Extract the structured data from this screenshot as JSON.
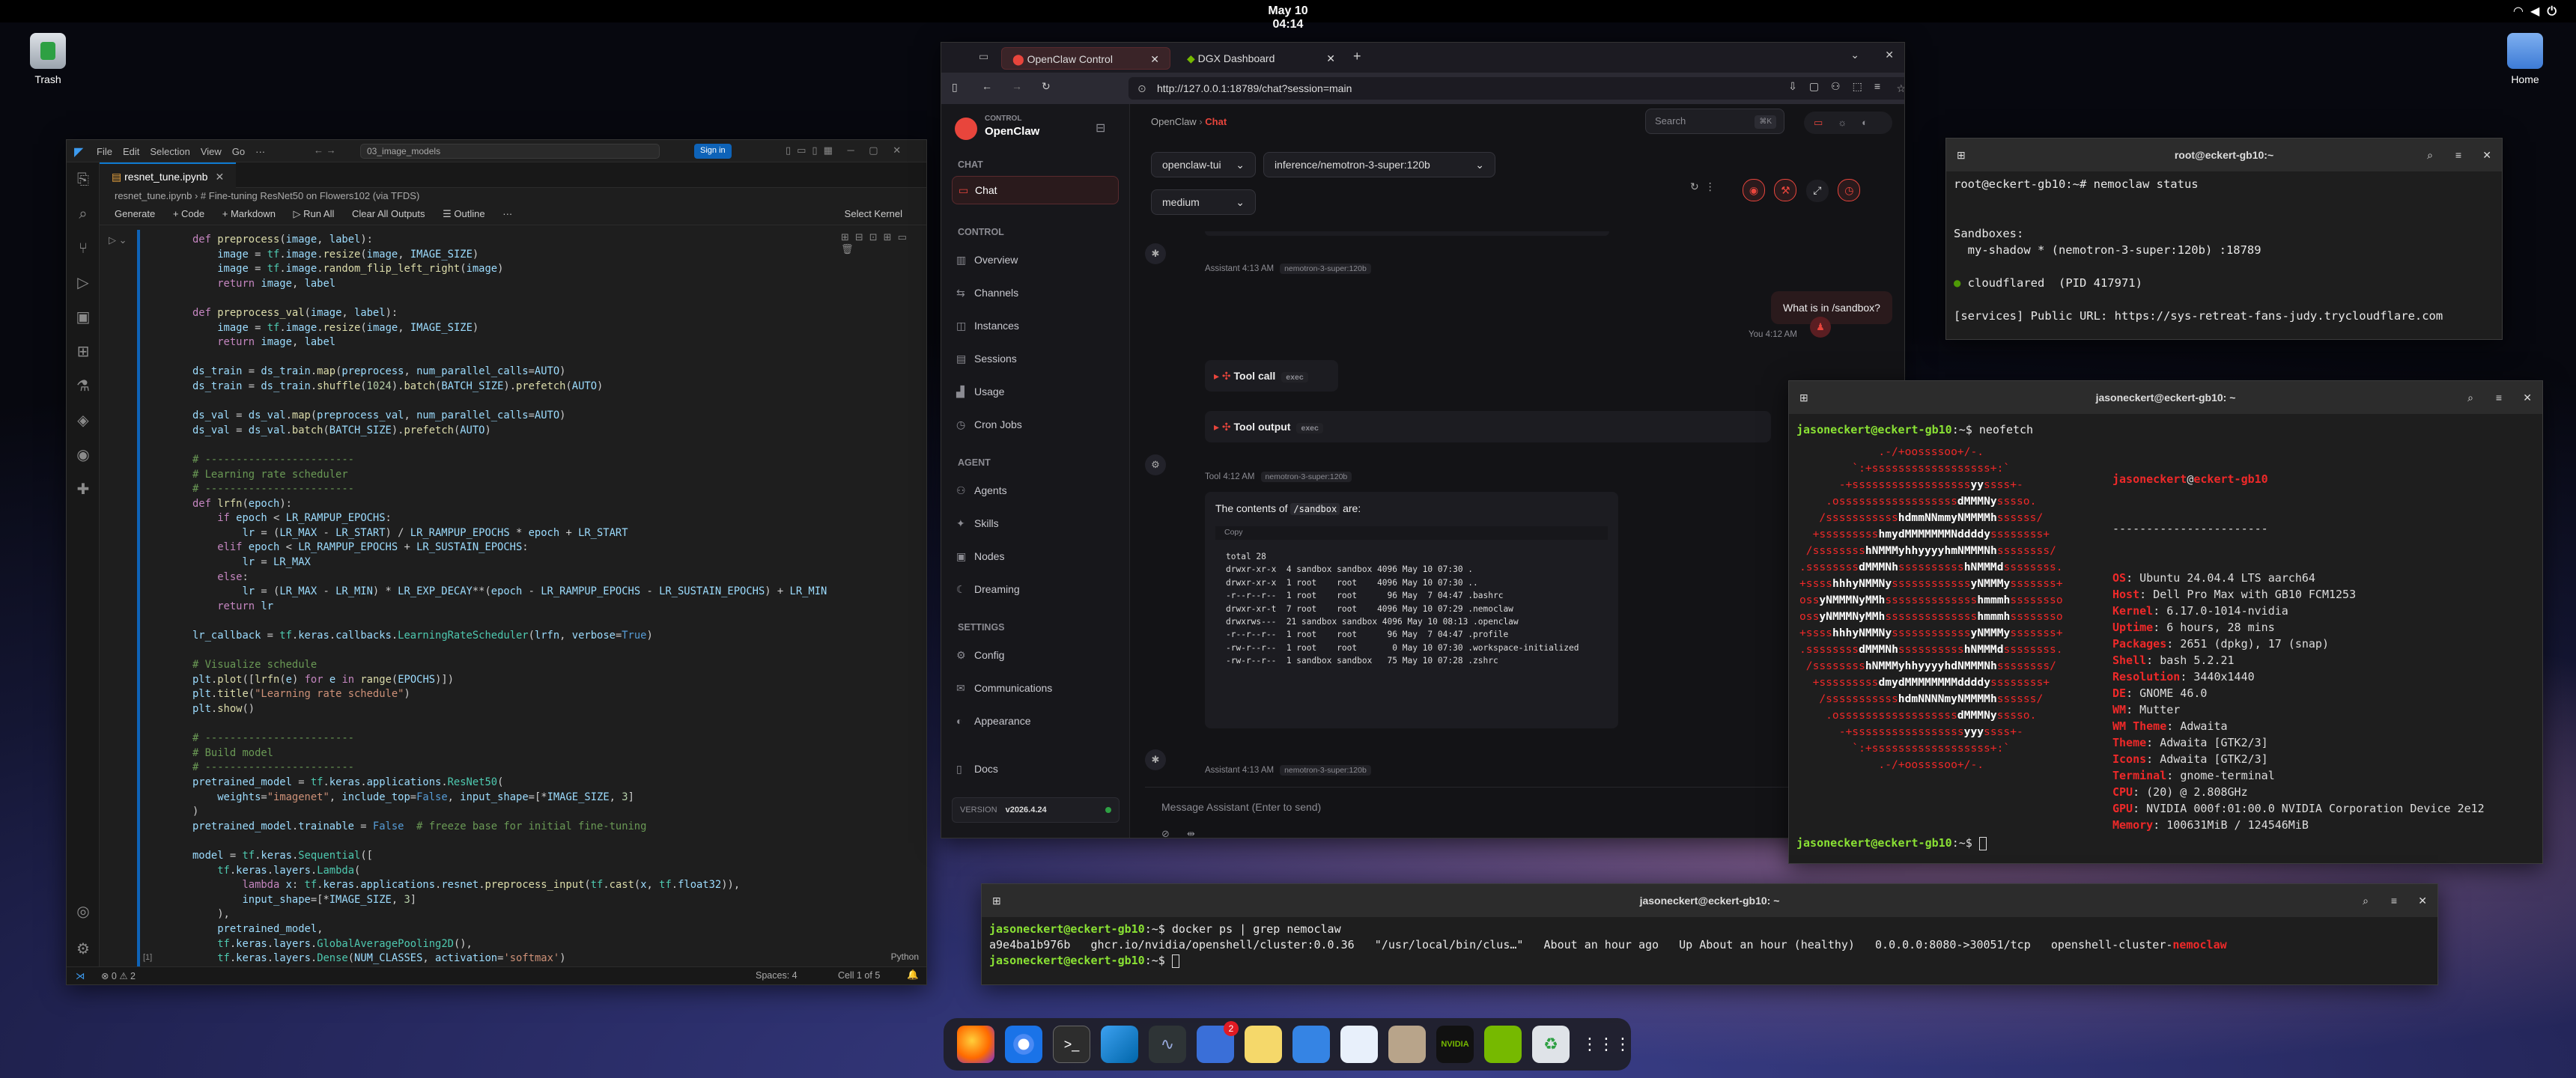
{
  "topbar": {
    "clock": "May 10  04:14"
  },
  "desktop": {
    "trash": "Trash",
    "home": "Home"
  },
  "vscode": {
    "menu": [
      "File",
      "Edit",
      "Selection",
      "View",
      "Go",
      "···"
    ],
    "search": "03_image_models",
    "signin": "Sign in",
    "tab": "resnet_tune.ipynb",
    "breadcrumb": "resnet_tune.ipynb  ›  # Fine-tuning ResNet50 on Flowers102 (via TFDS)",
    "toolbar": [
      "Generate",
      "+ Code",
      "+ Markdown",
      "▷ Run All",
      "Clear All Outputs",
      "☰ Outline",
      "···"
    ],
    "kernel": "Select Kernel",
    "cell_index": "[1]",
    "lang": "Python",
    "status": {
      "left": "⊗ 0 ⚠ 2",
      "spaces": "Spaces: 4",
      "cell": "Cell 1 of 5"
    }
  },
  "firefox": {
    "tab1": "OpenClaw Control",
    "tab2": "DGX Dashboard",
    "url": "http://127.0.0.1:18789/chat?session=main"
  },
  "openclaw": {
    "brand_small": "CONTROL",
    "brand": "OpenClaw",
    "crumb_root": "OpenClaw",
    "crumb_current": "Chat",
    "search": "Search",
    "search_kbd": "⌘K",
    "sections": {
      "chat": {
        "label": "CHAT",
        "items": [
          "Chat"
        ]
      },
      "control": {
        "label": "CONTROL",
        "items": [
          "Overview",
          "Channels",
          "Instances",
          "Sessions",
          "Usage",
          "Cron Jobs"
        ]
      },
      "agent": {
        "label": "AGENT",
        "items": [
          "Agents",
          "Skills",
          "Nodes",
          "Dreaming"
        ]
      },
      "settings": {
        "label": "SETTINGS",
        "items": [
          "Config",
          "Communications",
          "Appearance"
        ]
      }
    },
    "docs": "Docs",
    "version_label": "VERSION",
    "version": "v2026.4.24",
    "agent_select": "openclaw-tui",
    "model_select": "inference/nemotron-3-super:120b",
    "effort_select": "medium",
    "assistant": "Assistant",
    "time1": "4:13 AM",
    "model_tag": "nemotron-3-super:120b",
    "user_msg": "What is in /sandbox?",
    "you": "You",
    "time2": "4:12 AM",
    "tool_call": "Tool call",
    "tool_output": "Tool output",
    "exec": "exec",
    "tool_label": "Tool",
    "time3": "4:12 AM",
    "contents_a": "The contents of ",
    "contents_path": "/sandbox",
    "contents_b": " are:",
    "copy": "Copy",
    "listing": "total 28\ndrwxr-xr-x  4 sandbox sandbox 4096 May 10 07:30 .\ndrwxr-xr-x  1 root    root    4096 May 10 07:30 ..\n-r--r--r--  1 root    root      96 May  7 04:47 .bashrc\ndrwxr-xr-t  7 root    root    4096 May 10 07:29 .nemoclaw\ndrwxrws---  21 sandbox sandbox 4096 May 10 08:13 .openclaw\n-r--r--r--  1 root    root      96 May  7 04:47 .profile\n-rw-r--r--  1 root    root       0 May 10 07:30 .workspace-initialized\n-rw-r--r--  1 sandbox sandbox   75 May 10 07:28 .zshrc",
    "time4": "4:13 AM",
    "composer_placeholder": "Message Assistant (Enter to send)"
  },
  "term_status": {
    "title": "root@eckert-gb10:~",
    "prompt": "root@eckert-gb10:~# ",
    "cmd": "nemoclaw status",
    "l1": "Sandboxes:",
    "l2": "  my-shadow * (nemotron-3-super:120b) :18789",
    "dot": "●",
    "l3": " cloudflared  (PID 417971)",
    "l4": "[services] Public URL: https://sys-retreat-fans-judy.trycloudflare.com"
  },
  "term_neofetch": {
    "title": "jasoneckert@eckert-gb10: ~",
    "prompt_user": "jasoneckert@eckert-gb10",
    "prompt_rest": ":~$ ",
    "cmd": "neofetch",
    "user": "jasoneckert",
    "host": "eckert-gb10",
    "sep": "-----------------------",
    "info": [
      [
        "OS",
        "Ubuntu 24.04.4 LTS aarch64"
      ],
      [
        "Host",
        "Dell Pro Max with GB10 FCM1253"
      ],
      [
        "Kernel",
        "6.17.0-1014-nvidia"
      ],
      [
        "Uptime",
        "6 hours, 28 mins"
      ],
      [
        "Packages",
        "2651 (dpkg), 17 (snap)"
      ],
      [
        "Shell",
        "bash 5.2.21"
      ],
      [
        "Resolution",
        "3440x1440"
      ],
      [
        "DE",
        "GNOME 46.0"
      ],
      [
        "WM",
        "Mutter"
      ],
      [
        "WM Theme",
        "Adwaita"
      ],
      [
        "Theme",
        "Adwaita [GTK2/3]"
      ],
      [
        "Icons",
        "Adwaita [GTK2/3]"
      ],
      [
        "Terminal",
        "gnome-terminal"
      ],
      [
        "CPU",
        "(20) @ 2.808GHz"
      ],
      [
        "GPU",
        "NVIDIA 000f:01:00.0 NVIDIA Corporation Device 2e12"
      ],
      [
        "Memory",
        "100631MiB / 124546MiB"
      ]
    ],
    "logo": [
      "            .-/+oossssoo+/-.",
      "        `:+ssssssssssssssssss+:`",
      "      -+ssssssssssssssssssyyssss+-",
      "    .ossssssssssssssssssdMMMNysssso.",
      "   /ssssssssssshdmmNNmmyNMMMMhssssss/",
      "  +ssssssssshmydMMMMMMMNddddyssssssss+",
      " /sssssssshNMMMyhhyyyyhmNMMMNhssssssss/",
      ".ssssssssdMMMNhsssssssssshNMMMdssssssss.",
      "+sssshhhyNMMNyssssssssssssyNMMMysssssss+",
      "ossyNMMMNyMMhsssssssssssssshmmmhssssssso",
      "ossyNMMMNyMMhsssssssssssssshmmmhssssssso",
      "+sssshhhyNMMNyssssssssssssyNMMMysssssss+",
      ".ssssssssdMMMNhsssssssssshNMMMdssssssss.",
      " /sssssssshNMMMyhhyyyyhdNMMMNhssssssss/",
      "  +sssssssssdmydMMMMMMMMddddyssssssss+",
      "   /ssssssssssshdmNNNNmyNMMMMhssssss/",
      "    .ossssssssssssssssssdMMMNysssso.",
      "      -+sssssssssssssssssyyyssss+-",
      "        `:+ssssssssssssssssss+:`",
      "            .-/+oossssoo+/-."
    ],
    "palette": [
      "#2e3436",
      "#cc0000",
      "#4e9a06",
      "#c4a000",
      "#3465a4",
      "#75507b",
      "#06989a",
      "#d3d7cf",
      "#555753",
      "#ef2929",
      "#8ae234",
      "#fce94f",
      "#729fcf",
      "#ad7fa8",
      "#34e2e2",
      "#eeeeec"
    ]
  },
  "term_docker": {
    "title": "jasoneckert@eckert-gb10: ~",
    "prompt_user": "jasoneckert@eckert-gb10",
    "prompt_rest": ":~$ ",
    "cmd": "docker ps | grep nemoclaw",
    "row": "a9e4ba1b976b   ghcr.io/nvidia/openshell/cluster:0.0.36   \"/usr/local/bin/clus…\"   About an hour ago   Up About an hour (healthy)   0.0.0.0:8080->30051/tcp   openshell-cluster-",
    "row_hl": "nemoclaw"
  }
}
